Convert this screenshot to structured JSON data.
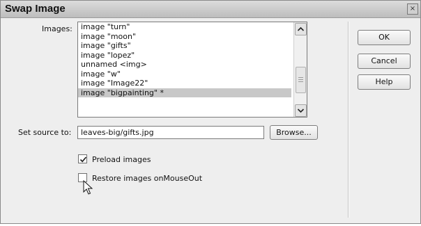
{
  "dialog": {
    "title": "Swap Image",
    "close_symbol": "×"
  },
  "images": {
    "label": "Images:",
    "items": [
      "image \"turn\"",
      "image \"moon\"",
      "image \"gifts\"",
      "image \"lopez\"",
      "unnamed <img>",
      "image \"w\"",
      "image \"Image22\"",
      "image \"bigpainting\" *"
    ],
    "selected_index": 7
  },
  "source": {
    "label": "Set source to:",
    "value": "leaves-big/gifts.jpg",
    "browse_label": "Browse..."
  },
  "options": {
    "preload_label": "Preload images",
    "preload_checked": true,
    "restore_label": "Restore images onMouseOut",
    "restore_checked": false
  },
  "buttons": {
    "ok": "OK",
    "cancel": "Cancel",
    "help": "Help"
  },
  "icons": {
    "scroll_up": "chevron-up-icon",
    "scroll_down": "chevron-down-icon",
    "check": "checkmark-icon",
    "cursor": "mouse-pointer-icon"
  }
}
